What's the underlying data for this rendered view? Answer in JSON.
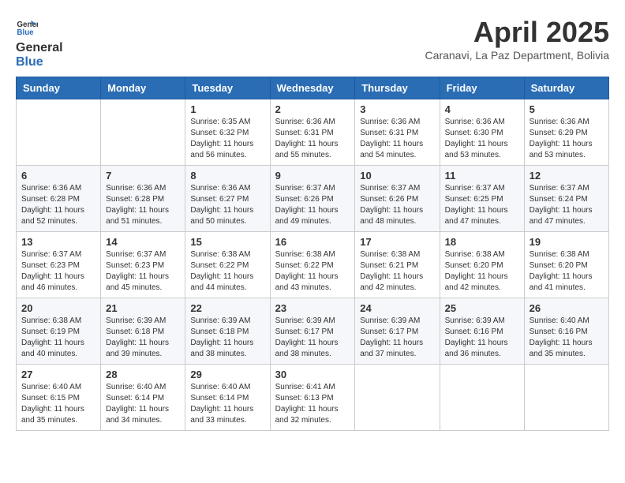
{
  "header": {
    "logo_general": "General",
    "logo_blue": "Blue",
    "month_year": "April 2025",
    "location": "Caranavi, La Paz Department, Bolivia"
  },
  "days_of_week": [
    "Sunday",
    "Monday",
    "Tuesday",
    "Wednesday",
    "Thursday",
    "Friday",
    "Saturday"
  ],
  "weeks": [
    [
      {
        "day": "",
        "info": ""
      },
      {
        "day": "",
        "info": ""
      },
      {
        "day": "1",
        "info": "Sunrise: 6:35 AM\nSunset: 6:32 PM\nDaylight: 11 hours and 56 minutes."
      },
      {
        "day": "2",
        "info": "Sunrise: 6:36 AM\nSunset: 6:31 PM\nDaylight: 11 hours and 55 minutes."
      },
      {
        "day": "3",
        "info": "Sunrise: 6:36 AM\nSunset: 6:31 PM\nDaylight: 11 hours and 54 minutes."
      },
      {
        "day": "4",
        "info": "Sunrise: 6:36 AM\nSunset: 6:30 PM\nDaylight: 11 hours and 53 minutes."
      },
      {
        "day": "5",
        "info": "Sunrise: 6:36 AM\nSunset: 6:29 PM\nDaylight: 11 hours and 53 minutes."
      }
    ],
    [
      {
        "day": "6",
        "info": "Sunrise: 6:36 AM\nSunset: 6:28 PM\nDaylight: 11 hours and 52 minutes."
      },
      {
        "day": "7",
        "info": "Sunrise: 6:36 AM\nSunset: 6:28 PM\nDaylight: 11 hours and 51 minutes."
      },
      {
        "day": "8",
        "info": "Sunrise: 6:36 AM\nSunset: 6:27 PM\nDaylight: 11 hours and 50 minutes."
      },
      {
        "day": "9",
        "info": "Sunrise: 6:37 AM\nSunset: 6:26 PM\nDaylight: 11 hours and 49 minutes."
      },
      {
        "day": "10",
        "info": "Sunrise: 6:37 AM\nSunset: 6:26 PM\nDaylight: 11 hours and 48 minutes."
      },
      {
        "day": "11",
        "info": "Sunrise: 6:37 AM\nSunset: 6:25 PM\nDaylight: 11 hours and 47 minutes."
      },
      {
        "day": "12",
        "info": "Sunrise: 6:37 AM\nSunset: 6:24 PM\nDaylight: 11 hours and 47 minutes."
      }
    ],
    [
      {
        "day": "13",
        "info": "Sunrise: 6:37 AM\nSunset: 6:23 PM\nDaylight: 11 hours and 46 minutes."
      },
      {
        "day": "14",
        "info": "Sunrise: 6:37 AM\nSunset: 6:23 PM\nDaylight: 11 hours and 45 minutes."
      },
      {
        "day": "15",
        "info": "Sunrise: 6:38 AM\nSunset: 6:22 PM\nDaylight: 11 hours and 44 minutes."
      },
      {
        "day": "16",
        "info": "Sunrise: 6:38 AM\nSunset: 6:22 PM\nDaylight: 11 hours and 43 minutes."
      },
      {
        "day": "17",
        "info": "Sunrise: 6:38 AM\nSunset: 6:21 PM\nDaylight: 11 hours and 42 minutes."
      },
      {
        "day": "18",
        "info": "Sunrise: 6:38 AM\nSunset: 6:20 PM\nDaylight: 11 hours and 42 minutes."
      },
      {
        "day": "19",
        "info": "Sunrise: 6:38 AM\nSunset: 6:20 PM\nDaylight: 11 hours and 41 minutes."
      }
    ],
    [
      {
        "day": "20",
        "info": "Sunrise: 6:38 AM\nSunset: 6:19 PM\nDaylight: 11 hours and 40 minutes."
      },
      {
        "day": "21",
        "info": "Sunrise: 6:39 AM\nSunset: 6:18 PM\nDaylight: 11 hours and 39 minutes."
      },
      {
        "day": "22",
        "info": "Sunrise: 6:39 AM\nSunset: 6:18 PM\nDaylight: 11 hours and 38 minutes."
      },
      {
        "day": "23",
        "info": "Sunrise: 6:39 AM\nSunset: 6:17 PM\nDaylight: 11 hours and 38 minutes."
      },
      {
        "day": "24",
        "info": "Sunrise: 6:39 AM\nSunset: 6:17 PM\nDaylight: 11 hours and 37 minutes."
      },
      {
        "day": "25",
        "info": "Sunrise: 6:39 AM\nSunset: 6:16 PM\nDaylight: 11 hours and 36 minutes."
      },
      {
        "day": "26",
        "info": "Sunrise: 6:40 AM\nSunset: 6:16 PM\nDaylight: 11 hours and 35 minutes."
      }
    ],
    [
      {
        "day": "27",
        "info": "Sunrise: 6:40 AM\nSunset: 6:15 PM\nDaylight: 11 hours and 35 minutes."
      },
      {
        "day": "28",
        "info": "Sunrise: 6:40 AM\nSunset: 6:14 PM\nDaylight: 11 hours and 34 minutes."
      },
      {
        "day": "29",
        "info": "Sunrise: 6:40 AM\nSunset: 6:14 PM\nDaylight: 11 hours and 33 minutes."
      },
      {
        "day": "30",
        "info": "Sunrise: 6:41 AM\nSunset: 6:13 PM\nDaylight: 11 hours and 32 minutes."
      },
      {
        "day": "",
        "info": ""
      },
      {
        "day": "",
        "info": ""
      },
      {
        "day": "",
        "info": ""
      }
    ]
  ]
}
